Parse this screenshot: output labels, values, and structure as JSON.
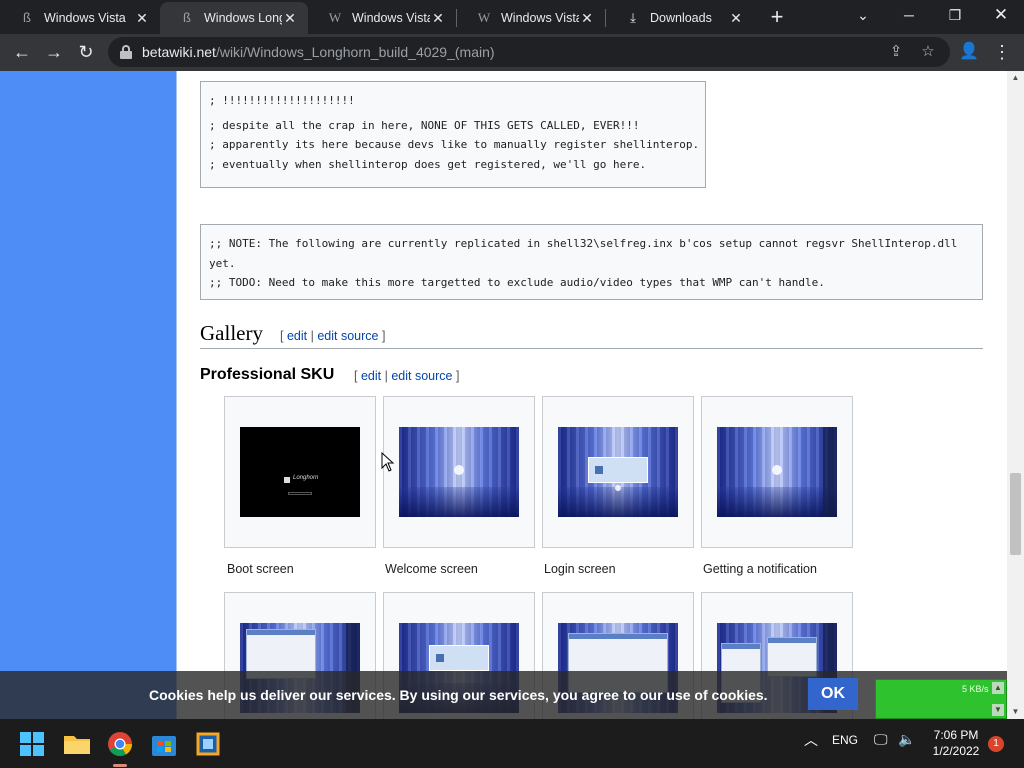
{
  "browser": {
    "tabs": [
      {
        "title": "Windows Vista",
        "favicon": "betawiki-icon",
        "active": false
      },
      {
        "title": "Windows Longh",
        "favicon": "betawiki-icon",
        "active": true
      },
      {
        "title": "Windows Vista (",
        "favicon": "wikipedia-icon",
        "active": false
      },
      {
        "title": "Windows Vista (",
        "favicon": "wikipedia-icon",
        "active": false
      },
      {
        "title": "Downloads",
        "favicon": "download-icon",
        "active": false
      }
    ],
    "url_host": "betawiki.net",
    "url_path": "/wiki/Windows_Longhorn_build_4029_(main)"
  },
  "page": {
    "code_block_1": [
      "; !!!!!!!!!!!!!!!!!!!!",
      "; despite all the crap in here, NONE OF THIS GETS CALLED, EVER!!!",
      "; apparently its here because devs like to manually register shellinterop.",
      "; eventually when shellinterop does get registered, we'll go here."
    ],
    "code_block_2": [
      ";; NOTE: The following are currently replicated in shell32\\selfreg.inx b'cos setup cannot regsvr ShellInterop.dll",
      "yet.",
      ";; TODO: Need to make this more targetted to exclude audio/video types that WMP can't handle."
    ],
    "gallery_heading": "Gallery",
    "subsection_heading": "Professional SKU",
    "edit_links": {
      "open": "[",
      "edit": "edit",
      "sep": "|",
      "edit_source": "edit source",
      "close": "]"
    },
    "gallery_captions": [
      "Boot screen",
      "Welcome screen",
      "Login screen",
      "Getting a notification"
    ],
    "boot_logo_text": "Longhorn"
  },
  "cookie_banner": {
    "text": "Cookies help us deliver our services. By using our services, you agree to our use of cookies.",
    "ok_label": "OK"
  },
  "net_monitor": {
    "rate": "5 KB/s"
  },
  "taskbar": {
    "apps": [
      "start-icon",
      "file-explorer-icon",
      "chrome-icon",
      "microsoft-store-icon",
      "virtualbox-icon"
    ],
    "language": "ENG",
    "time": "7:06 PM",
    "date": "1/2/2022",
    "notification_count": "1"
  },
  "colors": {
    "sidebar_blue": "#4d8df5",
    "link_blue": "#0645ad",
    "cookie_ok": "#3366cc",
    "net_monitor_green": "#2fc22f"
  }
}
